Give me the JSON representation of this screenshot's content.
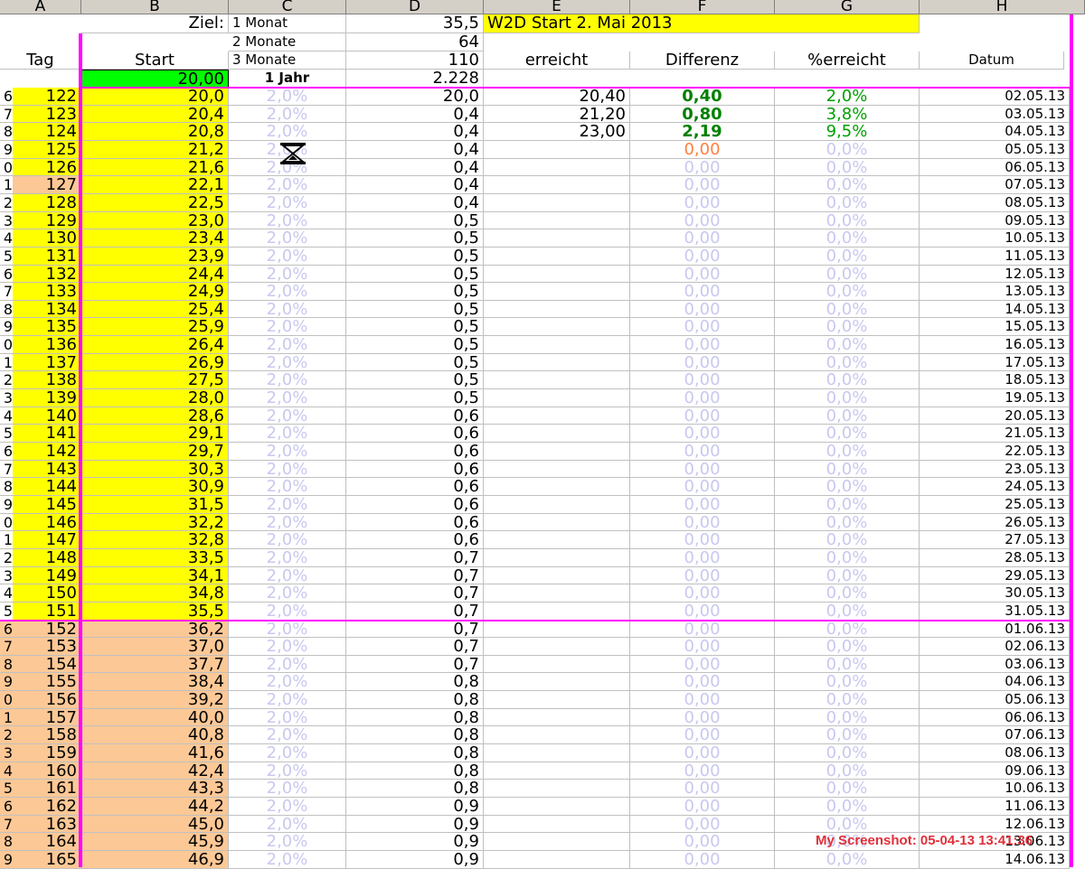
{
  "columns": [
    "A",
    "B",
    "C",
    "D",
    "E",
    "F",
    "G",
    "H"
  ],
  "header_rows": {
    "r1": {
      "B": "Ziel:",
      "C": "1 Monat",
      "D": "35,5",
      "E": "W2D Start 2. Mai 2013"
    },
    "r2": {
      "C": "2 Monate",
      "D": "64"
    },
    "r3": {
      "A": "Tag",
      "B": "Start",
      "C": "3 Monate",
      "D": "110",
      "E": "erreicht",
      "F": "Differenz",
      "G": "%erreicht",
      "H": "Datum"
    },
    "r4": {
      "B": "20,00",
      "C": "1 Jahr",
      "D": "2.228"
    }
  },
  "rows": [
    {
      "idx": "6",
      "tag": "122",
      "start": "20,0",
      "pct": "2,0%",
      "d": "20,0",
      "e": "20,40",
      "f": "0,40",
      "g": "2,0%",
      "date": "02.05.13"
    },
    {
      "idx": "7",
      "tag": "123",
      "start": "20,4",
      "pct": "2,0%",
      "d": "0,4",
      "e": "21,20",
      "f": "0,80",
      "g": "3,8%",
      "date": "03.05.13"
    },
    {
      "idx": "8",
      "tag": "124",
      "start": "20,8",
      "pct": "2,0%",
      "d": "0,4",
      "e": "23,00",
      "f": "2,19",
      "g": "9,5%",
      "date": "04.05.13"
    },
    {
      "idx": "9",
      "tag": "125",
      "start": "21,2",
      "pct": "2,0%",
      "d": "0,4",
      "e": "",
      "f": "0,00",
      "g": "0,0%",
      "date": "05.05.13"
    },
    {
      "idx": "0",
      "tag": "126",
      "start": "21,6",
      "pct": "2,0%",
      "d": "0,4",
      "e": "",
      "f": "0,00",
      "g": "0,0%",
      "date": "06.05.13"
    },
    {
      "idx": "1",
      "tag": "127",
      "start": "22,1",
      "pct": "2,0%",
      "d": "0,4",
      "e": "",
      "f": "0,00",
      "g": "0,0%",
      "date": "07.05.13"
    },
    {
      "idx": "2",
      "tag": "128",
      "start": "22,5",
      "pct": "2,0%",
      "d": "0,4",
      "e": "",
      "f": "0,00",
      "g": "0,0%",
      "date": "08.05.13"
    },
    {
      "idx": "3",
      "tag": "129",
      "start": "23,0",
      "pct": "2,0%",
      "d": "0,5",
      "e": "",
      "f": "0,00",
      "g": "0,0%",
      "date": "09.05.13"
    },
    {
      "idx": "4",
      "tag": "130",
      "start": "23,4",
      "pct": "2,0%",
      "d": "0,5",
      "e": "",
      "f": "0,00",
      "g": "0,0%",
      "date": "10.05.13"
    },
    {
      "idx": "5",
      "tag": "131",
      "start": "23,9",
      "pct": "2,0%",
      "d": "0,5",
      "e": "",
      "f": "0,00",
      "g": "0,0%",
      "date": "11.05.13"
    },
    {
      "idx": "6",
      "tag": "132",
      "start": "24,4",
      "pct": "2,0%",
      "d": "0,5",
      "e": "",
      "f": "0,00",
      "g": "0,0%",
      "date": "12.05.13"
    },
    {
      "idx": "7",
      "tag": "133",
      "start": "24,9",
      "pct": "2,0%",
      "d": "0,5",
      "e": "",
      "f": "0,00",
      "g": "0,0%",
      "date": "13.05.13"
    },
    {
      "idx": "8",
      "tag": "134",
      "start": "25,4",
      "pct": "2,0%",
      "d": "0,5",
      "e": "",
      "f": "0,00",
      "g": "0,0%",
      "date": "14.05.13"
    },
    {
      "idx": "9",
      "tag": "135",
      "start": "25,9",
      "pct": "2,0%",
      "d": "0,5",
      "e": "",
      "f": "0,00",
      "g": "0,0%",
      "date": "15.05.13"
    },
    {
      "idx": "0",
      "tag": "136",
      "start": "26,4",
      "pct": "2,0%",
      "d": "0,5",
      "e": "",
      "f": "0,00",
      "g": "0,0%",
      "date": "16.05.13"
    },
    {
      "idx": "1",
      "tag": "137",
      "start": "26,9",
      "pct": "2,0%",
      "d": "0,5",
      "e": "",
      "f": "0,00",
      "g": "0,0%",
      "date": "17.05.13"
    },
    {
      "idx": "2",
      "tag": "138",
      "start": "27,5",
      "pct": "2,0%",
      "d": "0,5",
      "e": "",
      "f": "0,00",
      "g": "0,0%",
      "date": "18.05.13"
    },
    {
      "idx": "3",
      "tag": "139",
      "start": "28,0",
      "pct": "2,0%",
      "d": "0,5",
      "e": "",
      "f": "0,00",
      "g": "0,0%",
      "date": "19.05.13"
    },
    {
      "idx": "4",
      "tag": "140",
      "start": "28,6",
      "pct": "2,0%",
      "d": "0,6",
      "e": "",
      "f": "0,00",
      "g": "0,0%",
      "date": "20.05.13"
    },
    {
      "idx": "5",
      "tag": "141",
      "start": "29,1",
      "pct": "2,0%",
      "d": "0,6",
      "e": "",
      "f": "0,00",
      "g": "0,0%",
      "date": "21.05.13"
    },
    {
      "idx": "6",
      "tag": "142",
      "start": "29,7",
      "pct": "2,0%",
      "d": "0,6",
      "e": "",
      "f": "0,00",
      "g": "0,0%",
      "date": "22.05.13"
    },
    {
      "idx": "7",
      "tag": "143",
      "start": "30,3",
      "pct": "2,0%",
      "d": "0,6",
      "e": "",
      "f": "0,00",
      "g": "0,0%",
      "date": "23.05.13"
    },
    {
      "idx": "8",
      "tag": "144",
      "start": "30,9",
      "pct": "2,0%",
      "d": "0,6",
      "e": "",
      "f": "0,00",
      "g": "0,0%",
      "date": "24.05.13"
    },
    {
      "idx": "9",
      "tag": "145",
      "start": "31,5",
      "pct": "2,0%",
      "d": "0,6",
      "e": "",
      "f": "0,00",
      "g": "0,0%",
      "date": "25.05.13"
    },
    {
      "idx": "0",
      "tag": "146",
      "start": "32,2",
      "pct": "2,0%",
      "d": "0,6",
      "e": "",
      "f": "0,00",
      "g": "0,0%",
      "date": "26.05.13"
    },
    {
      "idx": "1",
      "tag": "147",
      "start": "32,8",
      "pct": "2,0%",
      "d": "0,6",
      "e": "",
      "f": "0,00",
      "g": "0,0%",
      "date": "27.05.13"
    },
    {
      "idx": "2",
      "tag": "148",
      "start": "33,5",
      "pct": "2,0%",
      "d": "0,7",
      "e": "",
      "f": "0,00",
      "g": "0,0%",
      "date": "28.05.13"
    },
    {
      "idx": "3",
      "tag": "149",
      "start": "34,1",
      "pct": "2,0%",
      "d": "0,7",
      "e": "",
      "f": "0,00",
      "g": "0,0%",
      "date": "29.05.13"
    },
    {
      "idx": "4",
      "tag": "150",
      "start": "34,8",
      "pct": "2,0%",
      "d": "0,7",
      "e": "",
      "f": "0,00",
      "g": "0,0%",
      "date": "30.05.13"
    },
    {
      "idx": "5",
      "tag": "151",
      "start": "35,5",
      "pct": "2,0%",
      "d": "0,7",
      "e": "",
      "f": "0,00",
      "g": "0,0%",
      "date": "31.05.13"
    },
    {
      "idx": "6",
      "tag": "152",
      "start": "36,2",
      "pct": "2,0%",
      "d": "0,7",
      "e": "",
      "f": "0,00",
      "g": "0,0%",
      "date": "01.06.13"
    },
    {
      "idx": "7",
      "tag": "153",
      "start": "37,0",
      "pct": "2,0%",
      "d": "0,7",
      "e": "",
      "f": "0,00",
      "g": "0,0%",
      "date": "02.06.13"
    },
    {
      "idx": "8",
      "tag": "154",
      "start": "37,7",
      "pct": "2,0%",
      "d": "0,7",
      "e": "",
      "f": "0,00",
      "g": "0,0%",
      "date": "03.06.13"
    },
    {
      "idx": "9",
      "tag": "155",
      "start": "38,4",
      "pct": "2,0%",
      "d": "0,8",
      "e": "",
      "f": "0,00",
      "g": "0,0%",
      "date": "04.06.13"
    },
    {
      "idx": "0",
      "tag": "156",
      "start": "39,2",
      "pct": "2,0%",
      "d": "0,8",
      "e": "",
      "f": "0,00",
      "g": "0,0%",
      "date": "05.06.13"
    },
    {
      "idx": "1",
      "tag": "157",
      "start": "40,0",
      "pct": "2,0%",
      "d": "0,8",
      "e": "",
      "f": "0,00",
      "g": "0,0%",
      "date": "06.06.13"
    },
    {
      "idx": "2",
      "tag": "158",
      "start": "40,8",
      "pct": "2,0%",
      "d": "0,8",
      "e": "",
      "f": "0,00",
      "g": "0,0%",
      "date": "07.06.13"
    },
    {
      "idx": "3",
      "tag": "159",
      "start": "41,6",
      "pct": "2,0%",
      "d": "0,8",
      "e": "",
      "f": "0,00",
      "g": "0,0%",
      "date": "08.06.13"
    },
    {
      "idx": "4",
      "tag": "160",
      "start": "42,4",
      "pct": "2,0%",
      "d": "0,8",
      "e": "",
      "f": "0,00",
      "g": "0,0%",
      "date": "09.06.13"
    },
    {
      "idx": "5",
      "tag": "161",
      "start": "43,3",
      "pct": "2,0%",
      "d": "0,8",
      "e": "",
      "f": "0,00",
      "g": "0,0%",
      "date": "10.06.13"
    },
    {
      "idx": "6",
      "tag": "162",
      "start": "44,2",
      "pct": "2,0%",
      "d": "0,9",
      "e": "",
      "f": "0,00",
      "g": "0,0%",
      "date": "11.06.13"
    },
    {
      "idx": "7",
      "tag": "163",
      "start": "45,0",
      "pct": "2,0%",
      "d": "0,9",
      "e": "",
      "f": "0,00",
      "g": "0,0%",
      "date": "12.06.13"
    },
    {
      "idx": "8",
      "tag": "164",
      "start": "45,9",
      "pct": "2,0%",
      "d": "0,9",
      "e": "",
      "f": "0,00",
      "g": "0,0%",
      "date": "13.06.13"
    },
    {
      "idx": "9",
      "tag": "165",
      "start": "46,9",
      "pct": "2,0%",
      "d": "0,9",
      "e": "",
      "f": "0,00",
      "g": "0,0%",
      "date": "14.06.13"
    }
  ],
  "watermark": "My Screenshot: 05-04-13 13:41:36",
  "colors": {
    "yellow": "#ffff00",
    "peach": "#fcc896",
    "green": "#00ff00",
    "magenta": "#ff00ff",
    "faint": "#c8c8f0",
    "dark_green": "#008000",
    "orange": "#ff8040"
  },
  "icons": {
    "cursor": "hourglass-icon"
  }
}
